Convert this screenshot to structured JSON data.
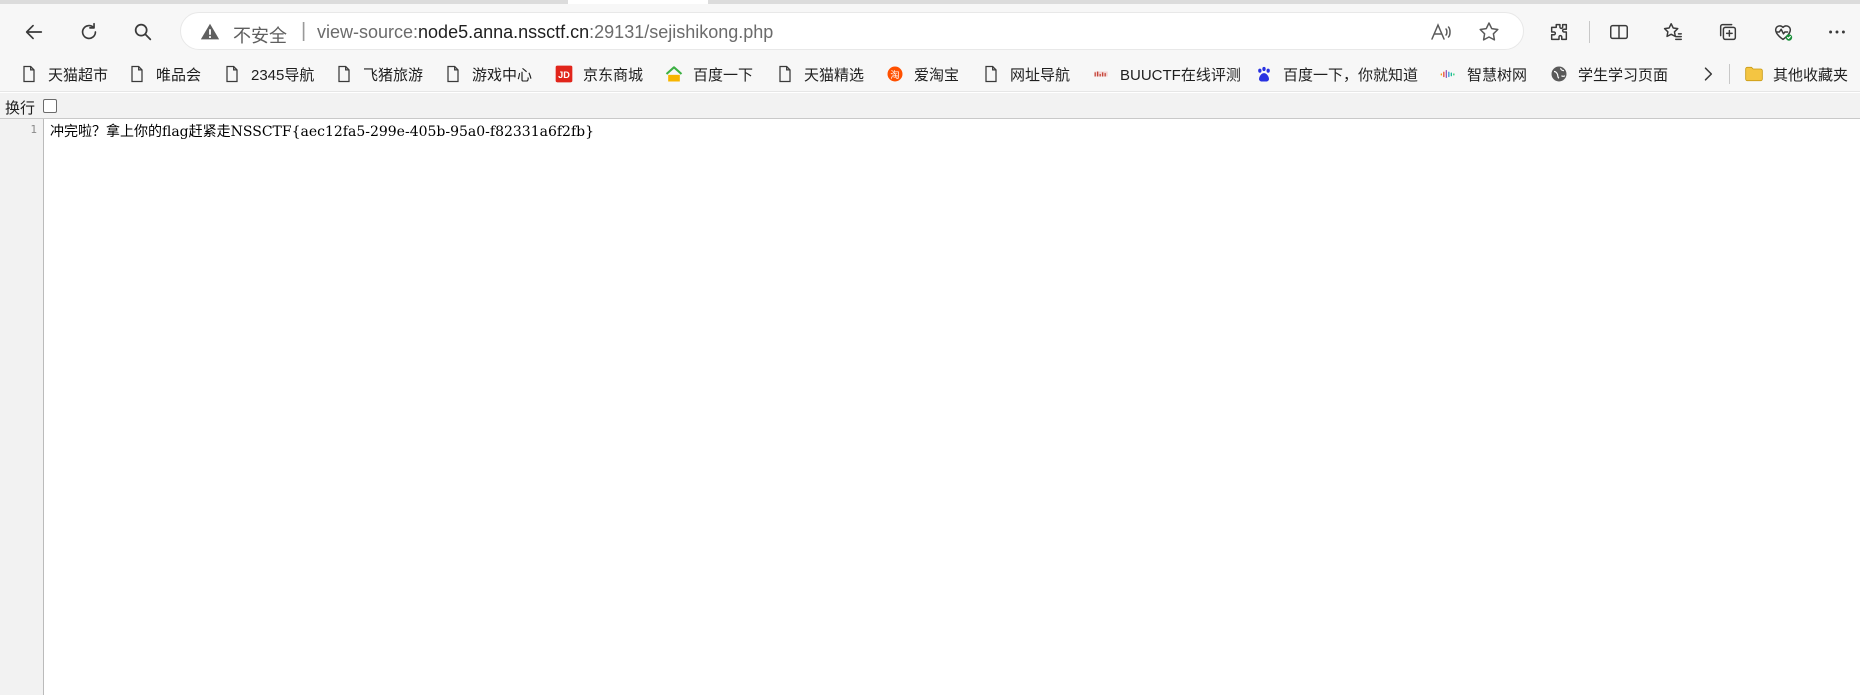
{
  "browser": {
    "address": {
      "security_text": "不安全",
      "separator": "|",
      "scheme": "view-source:",
      "host": "node5.anna.nssctf.cn",
      "path": ":29131/sejishikong.php"
    },
    "toolbar_icons": [
      "back-icon",
      "refresh-icon",
      "search-icon",
      "read-aloud-icon",
      "favorite-star-icon",
      "extensions-icon",
      "split-screen-icon",
      "favorites-icon",
      "collections-icon",
      "browser-essentials-icon",
      "more-icon"
    ]
  },
  "bookmarks": [
    {
      "label": "天猫超市",
      "icon": "page-icon"
    },
    {
      "label": "唯品会",
      "icon": "page-icon"
    },
    {
      "label": "2345导航",
      "icon": "page-icon"
    },
    {
      "label": "飞猪旅游",
      "icon": "page-icon"
    },
    {
      "label": "游戏中心",
      "icon": "page-icon"
    },
    {
      "label": "京东商城",
      "icon": "jd-icon"
    },
    {
      "label": "百度一下",
      "icon": "2345-icon"
    },
    {
      "label": "天猫精选",
      "icon": "page-icon"
    },
    {
      "label": "爱淘宝",
      "icon": "taobao-icon"
    },
    {
      "label": "网址导航",
      "icon": "page-icon"
    },
    {
      "label": "BUUCTF在线评测",
      "icon": "buuctf-icon"
    },
    {
      "label": "百度一下，你就知道",
      "icon": "baidu-paw-icon"
    },
    {
      "label": "智慧树网",
      "icon": "zhihuishu-icon"
    },
    {
      "label": "学生学习页面",
      "icon": "globe-icon"
    },
    {
      "label": "其他收藏夹",
      "icon": "folder-icon"
    }
  ],
  "view_source": {
    "wrap_label": "换行",
    "wrap_checked": false,
    "lines": [
      {
        "number": "1",
        "text": "冲完啦？拿上你的flag赶紧走NSSCTF{aec12fa5-299e-405b-95a0-f82331a6f2fb}"
      }
    ]
  },
  "colors": {
    "toolbar_bg": "#f7f7f7",
    "warning_gray": "#5f5f5f",
    "jd_red": "#e1251b",
    "taobao_orange": "#ff5000",
    "baidu_blue": "#2932e1",
    "folder_yellow": "#f4c542"
  }
}
